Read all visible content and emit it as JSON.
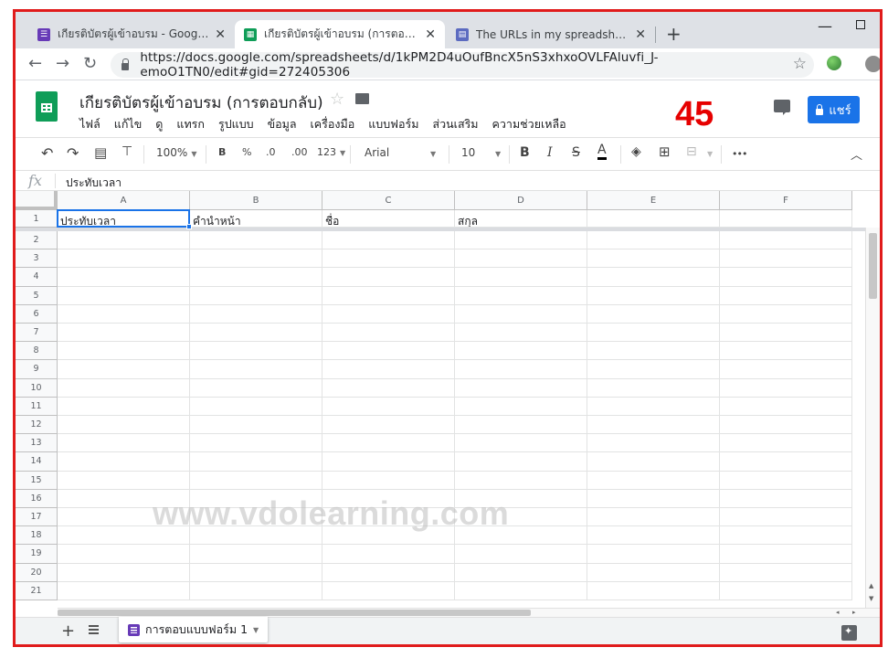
{
  "browser": {
    "tabs": [
      {
        "title": "เกียรติบัตรผู้เข้าอบรม - Google ฟอร์ม",
        "icon": "google-forms-icon",
        "color": "#673ab7",
        "active": false
      },
      {
        "title": "เกียรติบัตรผู้เข้าอบรม (การตอบกลับ) -",
        "icon": "google-sheets-icon",
        "color": "#0f9d58",
        "active": true
      },
      {
        "title": "The URLs in my spreadsheet resp",
        "icon": "stackoverflow-icon",
        "color": "#5c6bc0",
        "active": false
      }
    ],
    "url": "https://docs.google.com/spreadsheets/d/1kPM2D4uOufBncX5nS3xhxoOVLFAluvfi_J-emoO1TN0/edit#gid=272405306"
  },
  "doc": {
    "title": "เกียรติบัตรผู้เข้าอบรม (การตอบกลับ)",
    "menu": [
      "ไฟล์",
      "แก้ไข",
      "ดู",
      "แทรก",
      "รูปแบบ",
      "ข้อมูล",
      "เครื่องมือ",
      "แบบฟอร์ม",
      "ส่วนเสริม",
      "ความช่วยเหลือ"
    ],
    "share_label": "แชร์"
  },
  "overlay_counter": "45",
  "toolbar": {
    "zoom": "100%",
    "currency": "B",
    "percent": "%",
    "dec_decrease": ".0",
    "dec_increase": ".00",
    "more_formats": "123",
    "font": "Arial",
    "font_size": "10",
    "bold": "B",
    "italic": "I",
    "strike": "S",
    "text_color": "A",
    "more": "•••"
  },
  "formula_bar": {
    "fx": "fx",
    "value": "ประทับเวลา"
  },
  "grid": {
    "columns": [
      "A",
      "B",
      "C",
      "D",
      "E",
      "F"
    ],
    "row_count": 21,
    "header_row": [
      "ประทับเวลา",
      "คำนำหน้า",
      "ชื่อ",
      "สกุล",
      "",
      ""
    ],
    "selected_cell": "A1"
  },
  "watermark": "www.vdolearning.com",
  "sheet_tab": {
    "label": "การตอบแบบฟอร์ม 1"
  }
}
